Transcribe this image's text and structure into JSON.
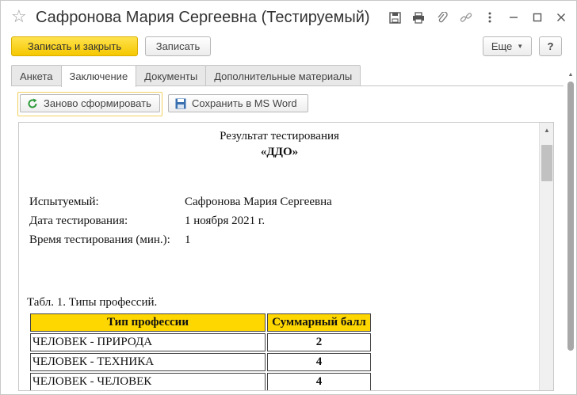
{
  "window": {
    "title": "Сафронова Мария Сергеевна (Тестируемый)",
    "star_glyph": "☆",
    "title_icons": [
      "save-icon",
      "print-icon",
      "attach-icon",
      "link-icon",
      "more-vertical-icon",
      "minimize-icon",
      "maximize-icon",
      "close-icon"
    ]
  },
  "toolbar": {
    "save_close_label": "Записать и закрыть",
    "save_label": "Записать",
    "more_label": "Еще",
    "help_label": "?"
  },
  "tabs": [
    {
      "label": "Анкета",
      "active": false
    },
    {
      "label": "Заключение",
      "active": true
    },
    {
      "label": "Документы",
      "active": false
    },
    {
      "label": "Дополнительные материалы",
      "active": false
    }
  ],
  "inner_toolbar": {
    "regenerate_label": "Заново сформировать",
    "save_word_label": "Сохранить в MS Word"
  },
  "document": {
    "title": "Результат тестирования",
    "subtitle": "«ДДО»",
    "fields": [
      {
        "label": "Испытуемый:",
        "value": "Сафронова Мария Сергеевна"
      },
      {
        "label": "Дата тестирования:",
        "value": "1 ноября 2021 г."
      },
      {
        "label": "Время тестирования (мин.):",
        "value": "1"
      }
    ],
    "table_caption": "Табл. 1. Типы профессий.",
    "table": {
      "headers": [
        "Тип профессии",
        "Суммарный балл"
      ],
      "rows": [
        {
          "type": "ЧЕЛОВЕК - ПРИРОДА",
          "score": "2"
        },
        {
          "type": "ЧЕЛОВЕК - ТЕХНИКА",
          "score": "4"
        },
        {
          "type": "ЧЕЛОВЕК - ЧЕЛОВЕК",
          "score": "4"
        }
      ]
    }
  },
  "colors": {
    "primary_button": "#f5c800",
    "table_header": "#ffd700",
    "regenerate_icon": "#2e9a3a",
    "word_icon": "#3a6fb0"
  }
}
